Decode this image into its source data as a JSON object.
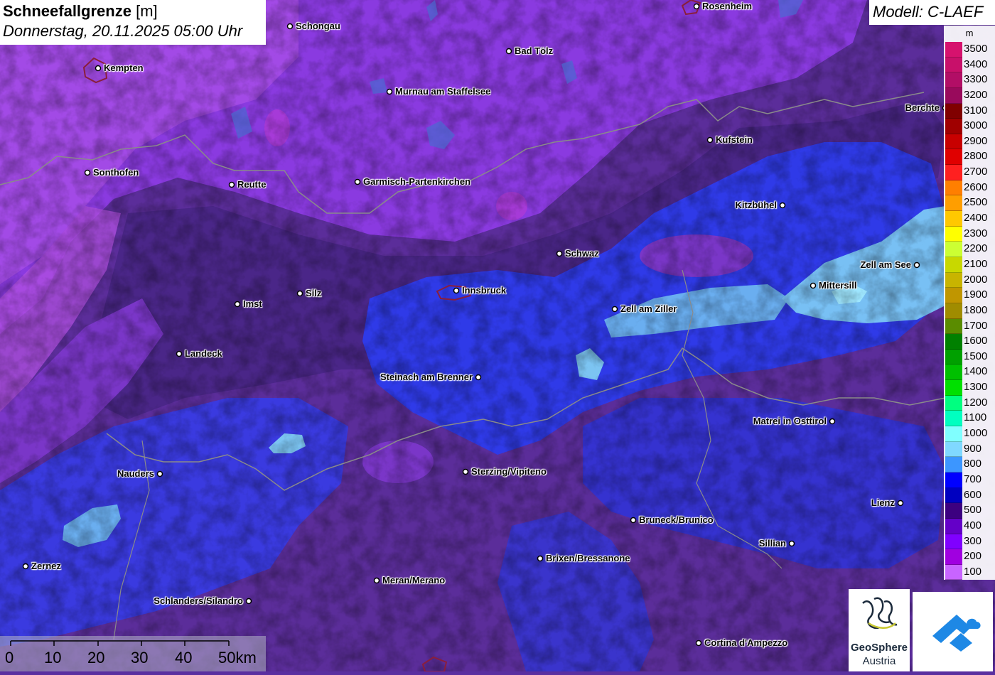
{
  "header": {
    "title_bold": "Schneefallgrenze",
    "title_unit": "[m]",
    "datetime": "Donnerstag, 20.11.2025 05:00 Uhr"
  },
  "model": {
    "label": "Modell: C-LAEF"
  },
  "legend": {
    "unit": "m",
    "items": [
      {
        "label": "3500",
        "color": "#d6126e"
      },
      {
        "label": "3400",
        "color": "#c8106a"
      },
      {
        "label": "3300",
        "color": "#b20e66"
      },
      {
        "label": "3200",
        "color": "#990a5c"
      },
      {
        "label": "3100",
        "color": "#800000"
      },
      {
        "label": "3000",
        "color": "#a00000"
      },
      {
        "label": "2900",
        "color": "#c80000"
      },
      {
        "label": "2800",
        "color": "#e00000"
      },
      {
        "label": "2700",
        "color": "#ff2020"
      },
      {
        "label": "2600",
        "color": "#ff7f00"
      },
      {
        "label": "2500",
        "color": "#ff9e00"
      },
      {
        "label": "2400",
        "color": "#ffc800"
      },
      {
        "label": "2300",
        "color": "#ffff00"
      },
      {
        "label": "2200",
        "color": "#ccff33"
      },
      {
        "label": "2100",
        "color": "#c8d800"
      },
      {
        "label": "2000",
        "color": "#c8b400"
      },
      {
        "label": "1900",
        "color": "#c09600"
      },
      {
        "label": "1800",
        "color": "#a08c00"
      },
      {
        "label": "1700",
        "color": "#5a8c00"
      },
      {
        "label": "1600",
        "color": "#008000"
      },
      {
        "label": "1500",
        "color": "#00a000"
      },
      {
        "label": "1400",
        "color": "#00c000"
      },
      {
        "label": "1300",
        "color": "#00e000"
      },
      {
        "label": "1200",
        "color": "#00ff80"
      },
      {
        "label": "1100",
        "color": "#00ffc0"
      },
      {
        "label": "1000",
        "color": "#80ffff"
      },
      {
        "label": "900",
        "color": "#80d8ff"
      },
      {
        "label": "800",
        "color": "#3c96ff"
      },
      {
        "label": "700",
        "color": "#0000ff"
      },
      {
        "label": "600",
        "color": "#0000c0"
      },
      {
        "label": "500",
        "color": "#3c0080"
      },
      {
        "label": "400",
        "color": "#6400c8"
      },
      {
        "label": "300",
        "color": "#8000ff"
      },
      {
        "label": "200",
        "color": "#a000e0"
      },
      {
        "label": "100",
        "color": "#c864ff"
      }
    ]
  },
  "cities": [
    {
      "name": "Rosenheim"
    },
    {
      "name": "Schongau"
    },
    {
      "name": "Bad Tölz"
    },
    {
      "name": "Kempten"
    },
    {
      "name": "Murnau am Staffelsee"
    },
    {
      "name": "Berchte"
    },
    {
      "name": "Kufstein"
    },
    {
      "name": "Sonthofen"
    },
    {
      "name": "Reutte"
    },
    {
      "name": "Garmisch-Partenkirchen"
    },
    {
      "name": "Kitzbühel"
    },
    {
      "name": "Schwaz"
    },
    {
      "name": "Zell am See"
    },
    {
      "name": "Mittersill"
    },
    {
      "name": "Innsbruck"
    },
    {
      "name": "Silz"
    },
    {
      "name": "Imst"
    },
    {
      "name": "Zell am Ziller"
    },
    {
      "name": "Landeck"
    },
    {
      "name": "Steinach am Brenner"
    },
    {
      "name": "Matrei in Osttirol"
    },
    {
      "name": "Nauders"
    },
    {
      "name": "Sterzing/Vipiteno"
    },
    {
      "name": "Lienz"
    },
    {
      "name": "Bruneck/Brunico"
    },
    {
      "name": "Sillian"
    },
    {
      "name": "Brixen/Bressanone"
    },
    {
      "name": "Zernez"
    },
    {
      "name": "Meran/Merano"
    },
    {
      "name": "Schlanders/Silandro"
    },
    {
      "name": "Cortina d'Ampezzo"
    }
  ],
  "scalebar": {
    "labels": [
      "0",
      "10",
      "20",
      "30",
      "40",
      "50km"
    ]
  },
  "logos": {
    "geosphere_line1": "GeoSphere",
    "geosphere_line2": "Austria"
  }
}
